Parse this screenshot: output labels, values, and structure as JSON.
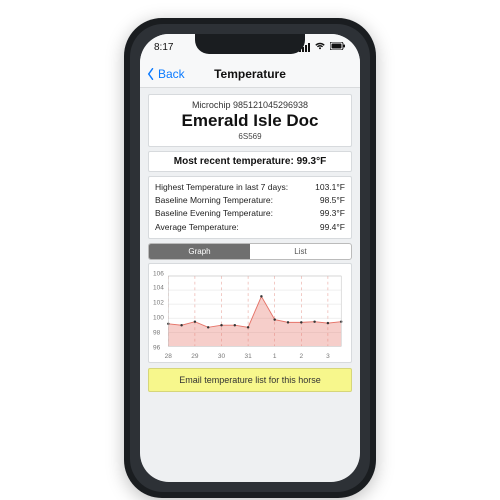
{
  "status": {
    "time": "8:17",
    "carrier_bars": 4
  },
  "nav": {
    "back": "Back",
    "title": "Temperature"
  },
  "header": {
    "microchip_prefix": "Microchip",
    "microchip": "985121045296938",
    "name": "Emerald Isle Doc",
    "id": "6S569"
  },
  "recent": {
    "label": "Most recent temperature:",
    "value": "99.3°F"
  },
  "stats": {
    "rows": [
      {
        "label": "Highest Temperature in last 7 days:",
        "value": "103.1°F"
      },
      {
        "label": "Baseline Morning Temperature:",
        "value": "98.5°F"
      },
      {
        "label": "Baseline Evening Temperature:",
        "value": "99.3°F"
      },
      {
        "label": "Average Temperature:",
        "value": "99.4°F"
      }
    ]
  },
  "segmented": {
    "graph": "Graph",
    "list": "List",
    "selected": "graph"
  },
  "email_button": "Email temperature list for this horse",
  "chart_data": {
    "type": "line",
    "ylim": [
      96,
      106
    ],
    "yticks": [
      96,
      98,
      100,
      102,
      104,
      106
    ],
    "xlabels": [
      "28",
      "29",
      "30",
      "31",
      "1",
      "2",
      "3"
    ],
    "series": [
      {
        "name": "temperature",
        "color": "#e57368",
        "values": [
          99.2,
          99.0,
          99.5,
          98.7,
          99.0,
          99.0,
          98.7,
          103.1,
          99.8,
          99.4,
          99.4,
          99.5,
          99.3,
          99.5
        ]
      }
    ]
  }
}
